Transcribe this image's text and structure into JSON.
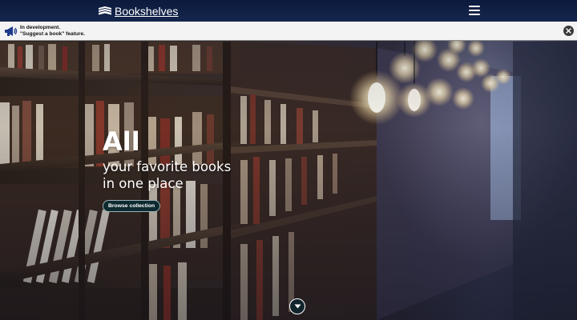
{
  "navbar": {
    "brand_name": "Bookshelves",
    "logo_icon": "books-icon",
    "menu_icon": "hamburger-icon"
  },
  "banner": {
    "icon": "megaphone-icon",
    "line1": "In development.",
    "line2": "\"Suggest a book\" feature.",
    "close_icon": "close-icon"
  },
  "hero": {
    "headline": "All",
    "tagline_line1": "your favorite books",
    "tagline_line2": "in one place",
    "cta_label": "Browse collection",
    "scroll_icon": "chevron-down-icon"
  },
  "colors": {
    "navbar": "#0c1a3d",
    "banner_bg": "#f3f3f3",
    "cta_bg": "#0d2a30",
    "text_light": "#ffffff"
  }
}
